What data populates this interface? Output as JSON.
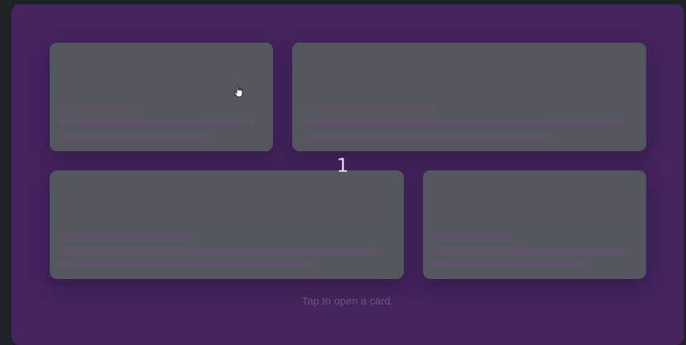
{
  "colors": {
    "page_background": "#1f2326",
    "stage_background": "#45245f",
    "card_background": "#55575e",
    "placeholder_line": "#5c5566",
    "counter_text": "#e4d3f2",
    "hint_text": "#6c577f"
  },
  "cards": [
    {
      "placeholder_lines": 3
    },
    {
      "placeholder_lines": 3
    },
    {
      "placeholder_lines": 3
    },
    {
      "placeholder_lines": 3
    }
  ],
  "counter": {
    "value": "1"
  },
  "hint": {
    "text": "Tap to open a card."
  },
  "cursor": {
    "icon": "hand-pointer-icon"
  }
}
